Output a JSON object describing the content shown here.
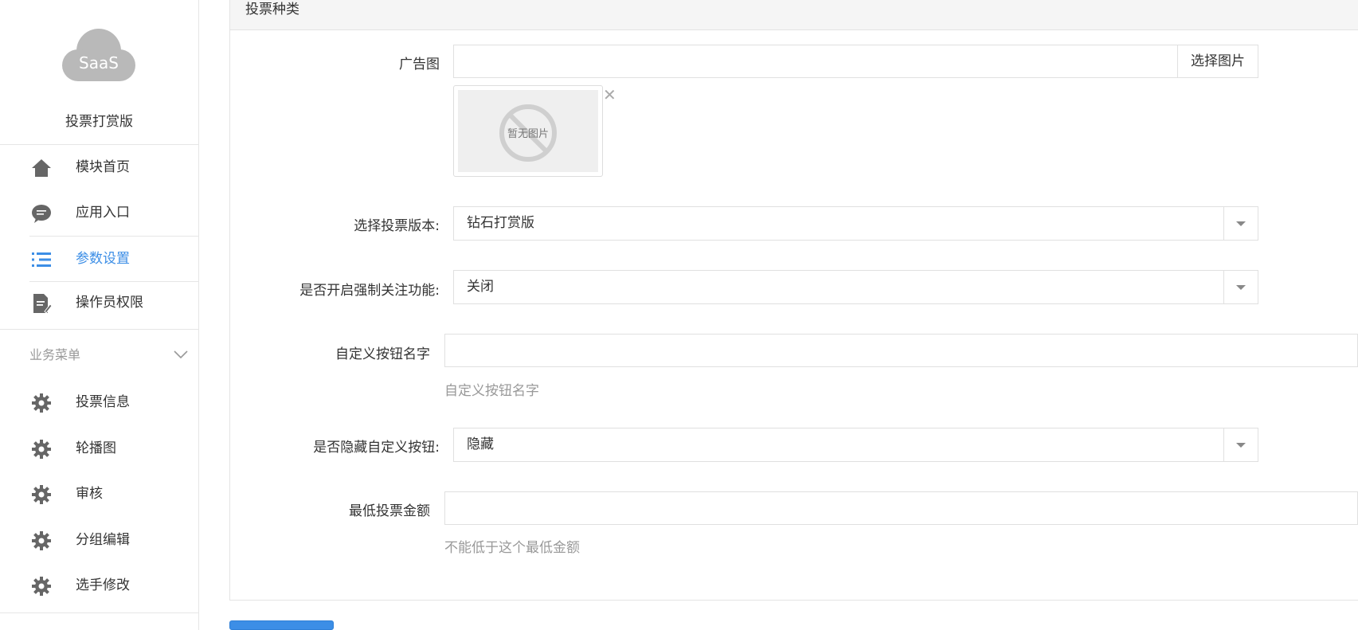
{
  "sidebar": {
    "logo_text": "SaaS",
    "app_name": "投票打赏版",
    "items": [
      {
        "label": "模块首页",
        "icon": "home-icon"
      },
      {
        "label": "应用入口",
        "icon": "chat-bubble-icon"
      },
      {
        "label": "参数设置",
        "icon": "list-settings-icon",
        "active": true
      },
      {
        "label": "操作员权限",
        "icon": "document-edit-icon"
      }
    ],
    "section": {
      "label": "业务菜单",
      "icon": "chevron-down-icon"
    },
    "business_items": [
      {
        "label": "投票信息",
        "icon": "gear-icon"
      },
      {
        "label": "轮播图",
        "icon": "gear-icon"
      },
      {
        "label": "审核",
        "icon": "gear-icon"
      },
      {
        "label": "分组编辑",
        "icon": "gear-icon"
      },
      {
        "label": "选手修改",
        "icon": "gear-icon"
      }
    ]
  },
  "panel": {
    "title": "投票种类",
    "ad_image": {
      "label": "广告图",
      "value": "",
      "pick_button": "选择图片",
      "no_image_text": "暂无图片"
    },
    "vote_version": {
      "label": "选择投票版本:",
      "selected": "钻石打赏版"
    },
    "force_follow": {
      "label": "是否开启强制关注功能:",
      "selected": "关闭"
    },
    "custom_button_name": {
      "label": "自定义按钮名字",
      "value": "",
      "help": "自定义按钮名字"
    },
    "hide_custom_button": {
      "label": "是否隐藏自定义按钮:",
      "selected": "隐藏"
    },
    "min_vote_amount": {
      "label": "最低投票金额",
      "value": "",
      "help": "不能低于这个最低金额"
    }
  },
  "colors": {
    "accent": "#3c8ee6",
    "border": "#e0e0e0",
    "muted": "#999999"
  }
}
